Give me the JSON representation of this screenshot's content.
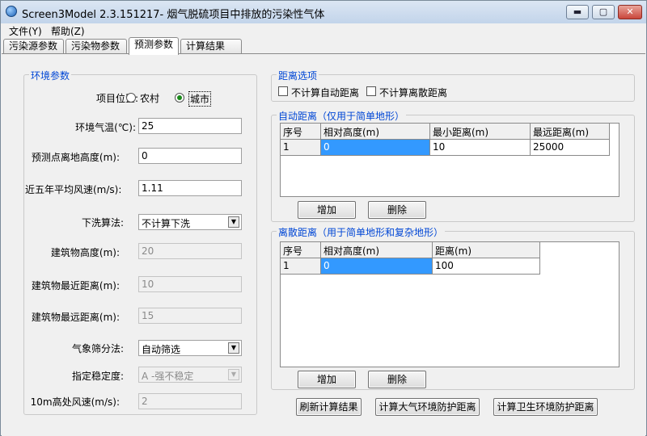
{
  "window": {
    "title": "Screen3Model 2.3.151217- 烟气脱硫项目中排放的污染性气体",
    "min_label": "▬",
    "max_label": "▢",
    "close_label": "✕"
  },
  "menu": [
    "文件(Y)",
    "帮助(Z)"
  ],
  "tabs": [
    "污染源参数",
    "污染物参数",
    "预测参数",
    "计算结果"
  ],
  "active_tab": 2,
  "env": {
    "title": "环境参数",
    "location_label": "项目位置:",
    "option_rural": "农村",
    "option_urban": "城市",
    "selected": "城市",
    "temp_label": "环境气温(℃):",
    "temp_value": "25",
    "height_label": "预测点离地高度(m):",
    "height_value": "0",
    "wind_label": "近五年平均风速(m/s):",
    "wind_value": "1.11",
    "downwash_label": "下洗算法:",
    "downwash_value": "不计算下洗",
    "bld_height_label": "建筑物高度(m):",
    "bld_height_value": "20",
    "bld_min_label": "建筑物最近距离(m):",
    "bld_min_value": "10",
    "bld_max_label": "建筑物最远距离(m):",
    "bld_max_value": "15",
    "met_label": "气象筛分法:",
    "met_value": "自动筛选",
    "stability_label": "指定稳定度:",
    "stability_value": "A -强不稳定",
    "wind10_label": "10m高处风速(m/s):",
    "wind10_value": "2"
  },
  "distance_options": {
    "title": "距离选项",
    "opt_auto": "不计算自动距离",
    "opt_discrete": "不计算离散距离"
  },
  "auto_distance": {
    "title": "自动距离（仅用于简单地形）",
    "columns": [
      "序号",
      "相对高度(m)",
      "最小距离(m)",
      "最远距离(m)"
    ],
    "rows": [
      [
        "1",
        "0",
        "10",
        "25000"
      ]
    ],
    "add_label": "增加",
    "delete_label": "删除"
  },
  "discrete_distance": {
    "title": "离散距离（用于简单地形和复杂地形）",
    "columns": [
      "序号",
      "相对高度(m)",
      "距离(m)"
    ],
    "rows": [
      [
        "1",
        "0",
        "100"
      ]
    ],
    "add_label": "增加",
    "delete_label": "删除"
  },
  "actions": {
    "refresh": "刷新计算结果",
    "air_protect": "计算大气环境防护距离",
    "health_protect": "计算卫生环境防护距离"
  }
}
